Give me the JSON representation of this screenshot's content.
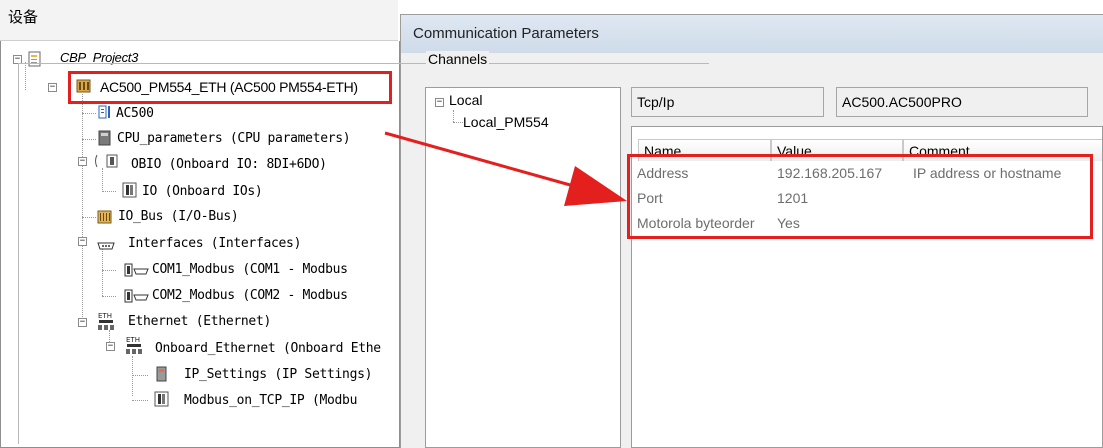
{
  "device_panel": {
    "title": "设备",
    "tree": {
      "project": "CBP_Project3",
      "plc": "AC500_PM554_ETH (AC500 PM554-ETH)",
      "ac500": "AC500",
      "cpu_parameters": "CPU_parameters (CPU parameters)",
      "obio": "OBIO (Onboard IO: 8DI+6DO)",
      "io": "IO (Onboard IOs)",
      "io_bus": "IO_Bus (I/O-Bus)",
      "interfaces": "Interfaces (Interfaces)",
      "com1": "COM1_Modbus (COM1 - Modbus",
      "com2": "COM2_Modbus (COM2 - Modbus",
      "ethernet": "Ethernet (Ethernet)",
      "onboard_ethernet": "Onboard_Ethernet (Onboard Ethe",
      "ip_settings": "IP_Settings (IP Settings)",
      "modbus_tcp": "Modbus_on_TCP_IP (Modbu"
    }
  },
  "dialog": {
    "title": "Communication Parameters",
    "channels_label": "Channels",
    "channels": {
      "root": "Local",
      "child": "Local_PM554"
    },
    "protocol": "Tcp/Ip",
    "target": "AC500.AC500PRO",
    "table": {
      "headers": [
        "Name",
        "Value",
        "Comment"
      ],
      "rows": [
        {
          "name": "Address",
          "value": "192.168.205.167",
          "comment": "IP address or hostname"
        },
        {
          "name": "Port",
          "value": "1201",
          "comment": ""
        },
        {
          "name": "Motorola byteorder",
          "value": "Yes",
          "comment": ""
        }
      ]
    }
  },
  "highlight_color": "#e4201e"
}
